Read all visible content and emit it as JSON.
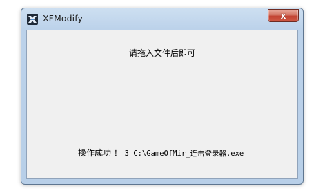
{
  "window": {
    "title": "XFModify",
    "close_glyph": "x",
    "app_icon": "xfmodify-app-icon",
    "close_icon": "close-icon"
  },
  "content": {
    "prompt": "请拖入文件后即可",
    "status_message": "操作成功 ！ ",
    "status_path": "3 C:\\GameOfMir_连击登录器.exe"
  },
  "colors": {
    "titlebar": "#bcd2ea",
    "client_bg": "#f0f0f0",
    "close_button": "#c24332"
  }
}
